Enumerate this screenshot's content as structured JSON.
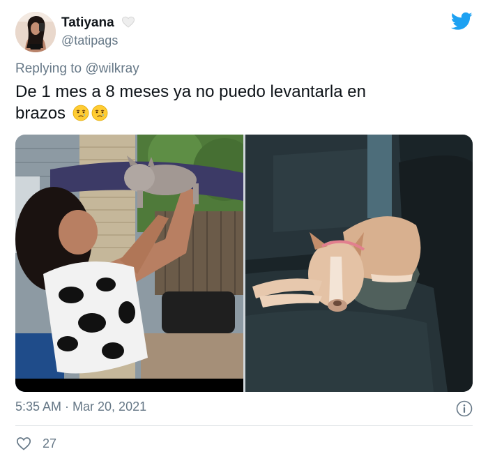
{
  "tweet": {
    "author_name": "Tatiyana",
    "author_handle": "@tatipags",
    "reply_prefix": "Replying to",
    "reply_to": "@wilkray",
    "text_line1": "De 1 mes a 8 meses ya no puedo levantarla en",
    "text_line2": "brazos",
    "emoji": [
      "crying-face-emoji",
      "crying-face-emoji"
    ],
    "timestamp": "5:35 AM · Mar 20, 2021",
    "likes": "27"
  },
  "media": [
    {
      "name": "woman-lifting-puppy-photo"
    },
    {
      "name": "dog-sleeping-in-car-photo"
    }
  ],
  "colors": {
    "twitter_blue": "#1da1f2",
    "secondary_text": "#657786",
    "primary_text": "#0f1419",
    "divider": "#dfe3e6"
  },
  "icons": [
    "twitter-bird-icon",
    "white-heart-icon",
    "info-icon",
    "heart-outline-icon"
  ]
}
